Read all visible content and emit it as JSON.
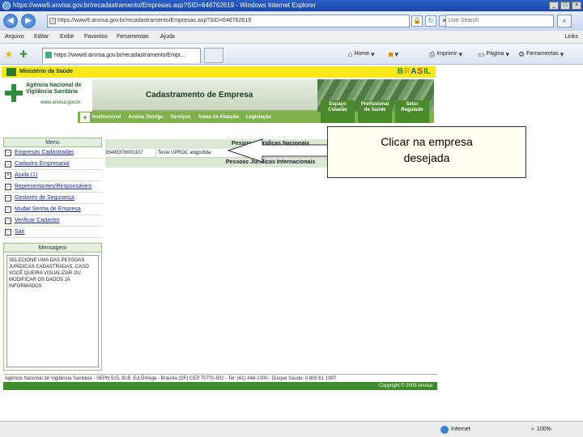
{
  "browser": {
    "title": "https://www9.anvisa.gov.br/recadastramento/Empresas.asp?SID=646762619 - Windows Internet Explorer",
    "url": "https://www9.anvisa.gov.br/recadastramento/Empresas.asp?SID=646762619",
    "search_placeholder": "Live Search",
    "menu": [
      "Arquivo",
      "Editar",
      "Exibir",
      "Favoritos",
      "Ferramentas",
      "Ajuda"
    ],
    "links_label": "Links",
    "tab_title": "https://www9.anvisa.gov.br/recadastramento/Empr...",
    "commands": {
      "home": "Home",
      "feeds": "",
      "print": "Imprimir",
      "page": "Página",
      "tools": "Ferramentas"
    },
    "status_zone": "Internet",
    "status_zoom": "100%"
  },
  "site": {
    "ministerio": "Ministério da Saúde",
    "brasil": [
      "B",
      "R",
      "A",
      "S",
      "IL"
    ],
    "agency_name": "Agência Nacional de Vigilância Sanitária",
    "agency_url": "www.anvisa.gov.br",
    "page_title": "Cadastramento de Empresa",
    "nav": [
      "Institucional",
      "Anvisa Divulga",
      "Serviços",
      "Áreas de Atuação",
      "Legislação"
    ],
    "nav_extra": [
      "Espaço Cidadão",
      "Profissional de Saúde",
      "Setor Regulado"
    ]
  },
  "menu_panel": {
    "title": "Menu",
    "items": [
      {
        "icon": "-",
        "label": "Empresas Cadastradas"
      },
      {
        "icon": "-",
        "label": "Cadastro Empresarial"
      },
      {
        "icon": "+",
        "label": "Ajuda (1)"
      },
      {
        "icon": "-",
        "label": "Representantes/Responsáveis"
      },
      {
        "icon": "-",
        "label": "Gestores de Segurança"
      },
      {
        "icon": "-",
        "label": "Mudar Senha de Empresa"
      },
      {
        "icon": "-",
        "label": "Verificar Cadastro"
      },
      {
        "icon": "-",
        "label": "Sair"
      }
    ]
  },
  "message_panel": {
    "title": "Mensagem",
    "text": "SELECIONE UMA DAS PESSOAS JURÍDICAS CADASTRADAS, CASO VOCÊ QUEIRA VISUALIZAR OU MODIFICAR OS DADOS JÁ INFORMADOS"
  },
  "table": {
    "header_nacionais": "Pessoas Jurídicas Nacionais",
    "rows": [
      {
        "cnpj": "35495376000107",
        "nome": "Teste UPROC ahgpcltda"
      }
    ],
    "header_internacionais": "Pessoas Jurídicas Internacionais"
  },
  "callout": {
    "line1": "Clicar na empresa",
    "line2": "desejada"
  },
  "footer": {
    "address": "Agência Nacional de Vigilância Sanitária - SEPN 515, Bl.B, Ed.Ômega - Brasília (DF) CEP 70770-502 - Tel: (61) 448-1000 - Disque Saúde: 0 800 61 1997",
    "copyright": "Copyright © 2003 Anvisa"
  }
}
